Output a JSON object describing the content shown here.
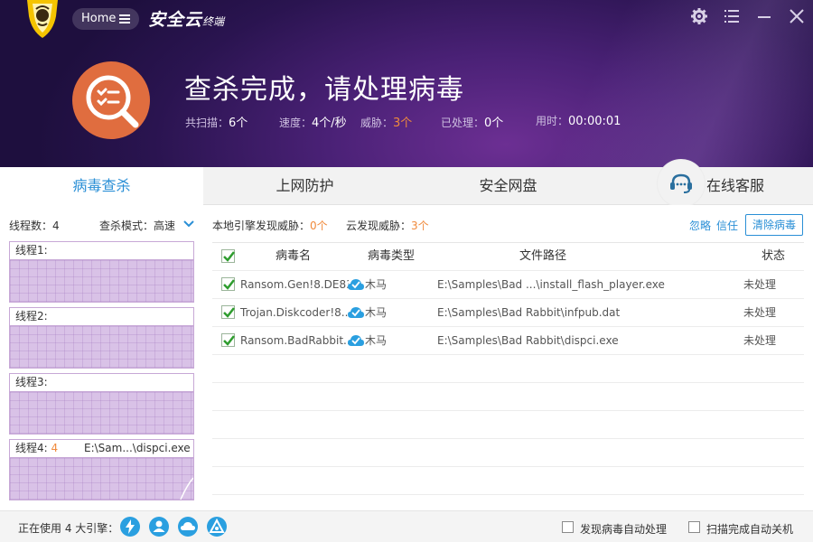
{
  "header": {
    "home_label": "Home",
    "brand_main": "安全云",
    "brand_sub": "终端",
    "title": "查杀完成，请处理病毒",
    "stats": [
      {
        "label": "共扫描：",
        "value": "6个",
        "highlight": false
      },
      {
        "label": "速度：",
        "value": "4个/秒",
        "highlight": false
      },
      {
        "label": "威胁：",
        "value": "3个",
        "highlight": true
      },
      {
        "label": "已处理：",
        "value": "0个",
        "highlight": false
      },
      {
        "label": "用时：",
        "value": "00:00:01",
        "highlight": false
      }
    ],
    "icons": [
      "lion-logo-icon",
      "gear-icon",
      "menu-icon",
      "minimize-icon",
      "close-icon",
      "scan-result-icon"
    ]
  },
  "tabs": [
    {
      "label": "病毒查杀",
      "active": true
    },
    {
      "label": "上网防护",
      "active": false
    },
    {
      "label": "安全网盘",
      "active": false
    },
    {
      "label": "在线客服",
      "active": false
    }
  ],
  "left_panel": {
    "thread_count_label": "线程数：",
    "thread_count": "4",
    "mode_label": "查杀模式：",
    "mode_value": "高速",
    "threads": [
      {
        "label": "线程1:",
        "count": "",
        "path": ""
      },
      {
        "label": "线程2:",
        "count": "",
        "path": ""
      },
      {
        "label": "线程3:",
        "count": "",
        "path": ""
      },
      {
        "label": "线程4:",
        "count": "4",
        "path": "E:\\Sam...\\dispci.exe"
      }
    ]
  },
  "summary": {
    "local_label": "本地引擎发现威胁：",
    "local_value": "0个",
    "cloud_label": "云发现威胁：",
    "cloud_value": "3个",
    "ignore_label": "忽略",
    "trust_label": "信任",
    "clean_label": "清除病毒"
  },
  "table": {
    "headers": {
      "name": "病毒名",
      "type": "病毒类型",
      "path": "文件路径",
      "status": "状态"
    },
    "rows": [
      {
        "name": "Ransom.Gen!8.DE83",
        "type": "木马",
        "path": "E:\\Samples\\Bad ...\\install_flash_player.exe",
        "status": "未处理",
        "checked": true
      },
      {
        "name": "Trojan.Diskcoder!8...",
        "type": "木马",
        "path": "E:\\Samples\\Bad Rabbit\\infpub.dat",
        "status": "未处理",
        "checked": true
      },
      {
        "name": "Ransom.BadRabbit...",
        "type": "木马",
        "path": "E:\\Samples\\Bad Rabbit\\dispci.exe",
        "status": "未处理",
        "checked": true
      }
    ],
    "empty_rows": 5
  },
  "footer": {
    "engines_label": "正在使用 4 大引擎：",
    "engine_icons": [
      "lightning-engine-icon",
      "user-engine-icon",
      "cloud-engine-icon",
      "triangle-engine-icon"
    ],
    "option1": "发现病毒自动处理",
    "option2": "扫描完成自动关机"
  },
  "colors": {
    "accent": "#2a8fd6",
    "warning": "#f08a3c",
    "header_purple": "#4a2176",
    "thread_fill": "#d9c2e7"
  }
}
